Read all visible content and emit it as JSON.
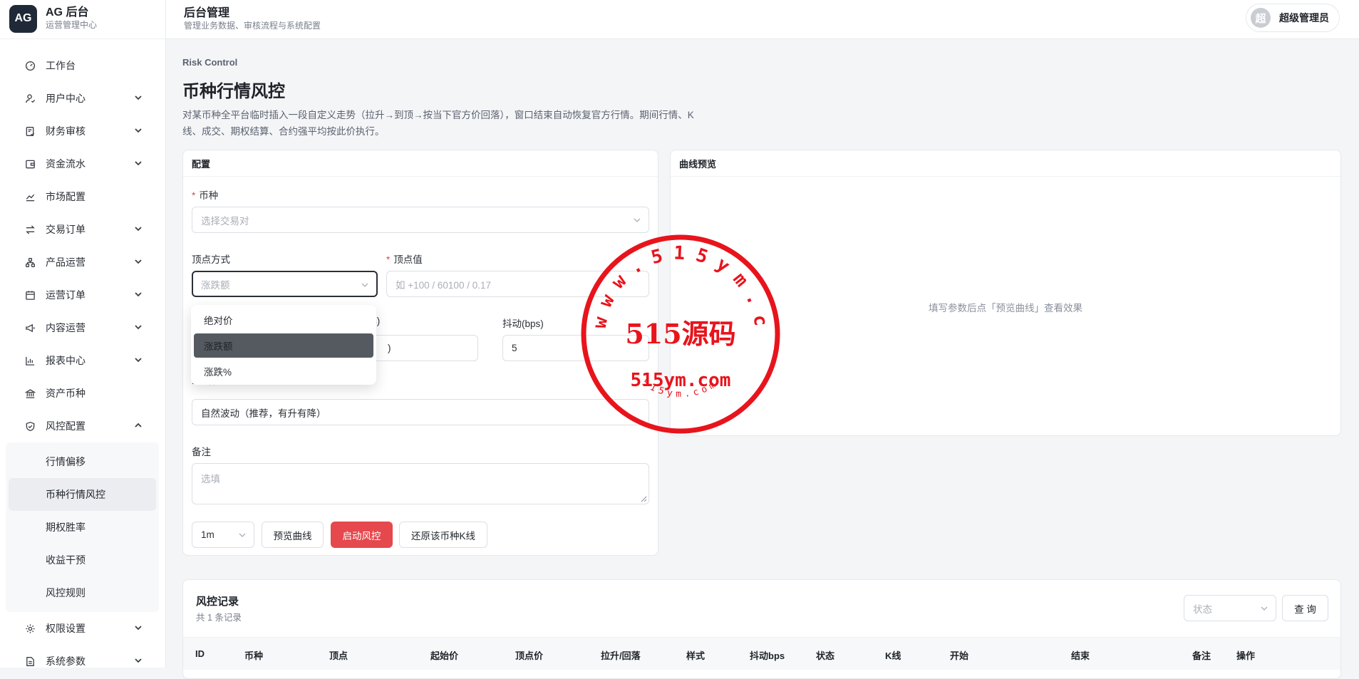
{
  "brand": {
    "logo": "AG",
    "title": "AG 后台",
    "subtitle": "运营管理中心"
  },
  "header": {
    "title": "后台管理",
    "subtitle": "管理业务数据、审核流程与系统配置"
  },
  "user": {
    "avatar": "超",
    "name": "超级管理员"
  },
  "menu": {
    "items": [
      {
        "label": "工作台",
        "icon": "dashboard-icon"
      },
      {
        "label": "用户中心",
        "icon": "user-icon"
      },
      {
        "label": "财务审核",
        "icon": "audit-icon"
      },
      {
        "label": "资金流水",
        "icon": "wallet-icon"
      },
      {
        "label": "市场配置",
        "icon": "line-chart-icon"
      },
      {
        "label": "交易订单",
        "icon": "swap-icon"
      },
      {
        "label": "产品运营",
        "icon": "cluster-icon"
      },
      {
        "label": "运营订单",
        "icon": "calendar-icon"
      },
      {
        "label": "内容运营",
        "icon": "megaphone-icon"
      },
      {
        "label": "报表中心",
        "icon": "bar-chart-icon"
      },
      {
        "label": "资产币种",
        "icon": "bank-icon"
      },
      {
        "label": "风控配置",
        "icon": "shield-icon"
      },
      {
        "label": "权限设置",
        "icon": "gear-icon"
      },
      {
        "label": "系统参数",
        "icon": "document-icon"
      }
    ],
    "risk_sub": [
      "行情偏移",
      "币种行情风控",
      "期权胜率",
      "收益干预",
      "风控规则"
    ]
  },
  "page": {
    "eyebrow": "Risk Control",
    "title": "币种行情风控",
    "desc": "对某币种全平台临时插入一段自定义走势（拉升→到顶→按当下官方价回落），窗口结束自动恢复官方行情。期间行情、K线、成交、期权结算、合约强平均按此价执行。"
  },
  "config": {
    "title": "配置",
    "symbol_label": "币种",
    "symbol_placeholder": "选择交易对",
    "peak_mode_label": "顶点方式",
    "peak_mode_value": "涨跌额",
    "peak_value_label": "顶点值",
    "peak_value_placeholder": "如 +100 / 60100 / 0.17",
    "row3_label_suffix": "s)",
    "rise_value": ")",
    "jitter_label": "抖动(bps)",
    "jitter_value": "5",
    "style_label_partial": "K线样式",
    "style_value": "自然波动（推荐，有升有降）",
    "remark_label": "备注",
    "remark_placeholder": "选填",
    "interval": "1m",
    "btn_preview": "预览曲线",
    "btn_start": "启动风控",
    "btn_restore": "还原该币种K线"
  },
  "dropdown": {
    "options": [
      "绝对价",
      "涨跌额",
      "涨跌%"
    ],
    "selected": "涨跌额"
  },
  "preview": {
    "title": "曲线预览",
    "empty": "填写参数后点「预览曲线」查看效果"
  },
  "records": {
    "title": "风控记录",
    "count": "共 1 条记录",
    "status_placeholder": "状态",
    "query": "查 询",
    "columns": [
      "ID",
      "币种",
      "顶点",
      "起始价",
      "顶点价",
      "拉升/回落",
      "样式",
      "抖动bps",
      "状态",
      "K线",
      "开始",
      "结束",
      "备注",
      "操作"
    ]
  },
  "watermark": {
    "top_arc": "www.515ym.com",
    "center": "515源码",
    "domain": "515ym.com",
    "bottom_arc": "515ym.com"
  }
}
